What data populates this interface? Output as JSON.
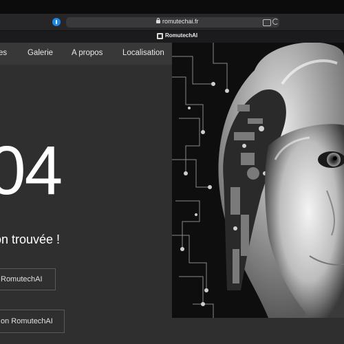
{
  "browser": {
    "url": "romutechai.fr",
    "tab_title": "RomutechAI"
  },
  "nav": {
    "items": [
      "es",
      "Galerie",
      "A propos",
      "Localisation"
    ]
  },
  "error": {
    "code": "04",
    "message": "on trouvée !"
  },
  "buttons": {
    "primary": "RomutechAI",
    "secondary": "on RomutechAI"
  },
  "colors": {
    "page_bg": "#2f2f2f",
    "nav_bg": "#383838",
    "text": "#ffffff",
    "button_border": "#5a5a5a"
  }
}
